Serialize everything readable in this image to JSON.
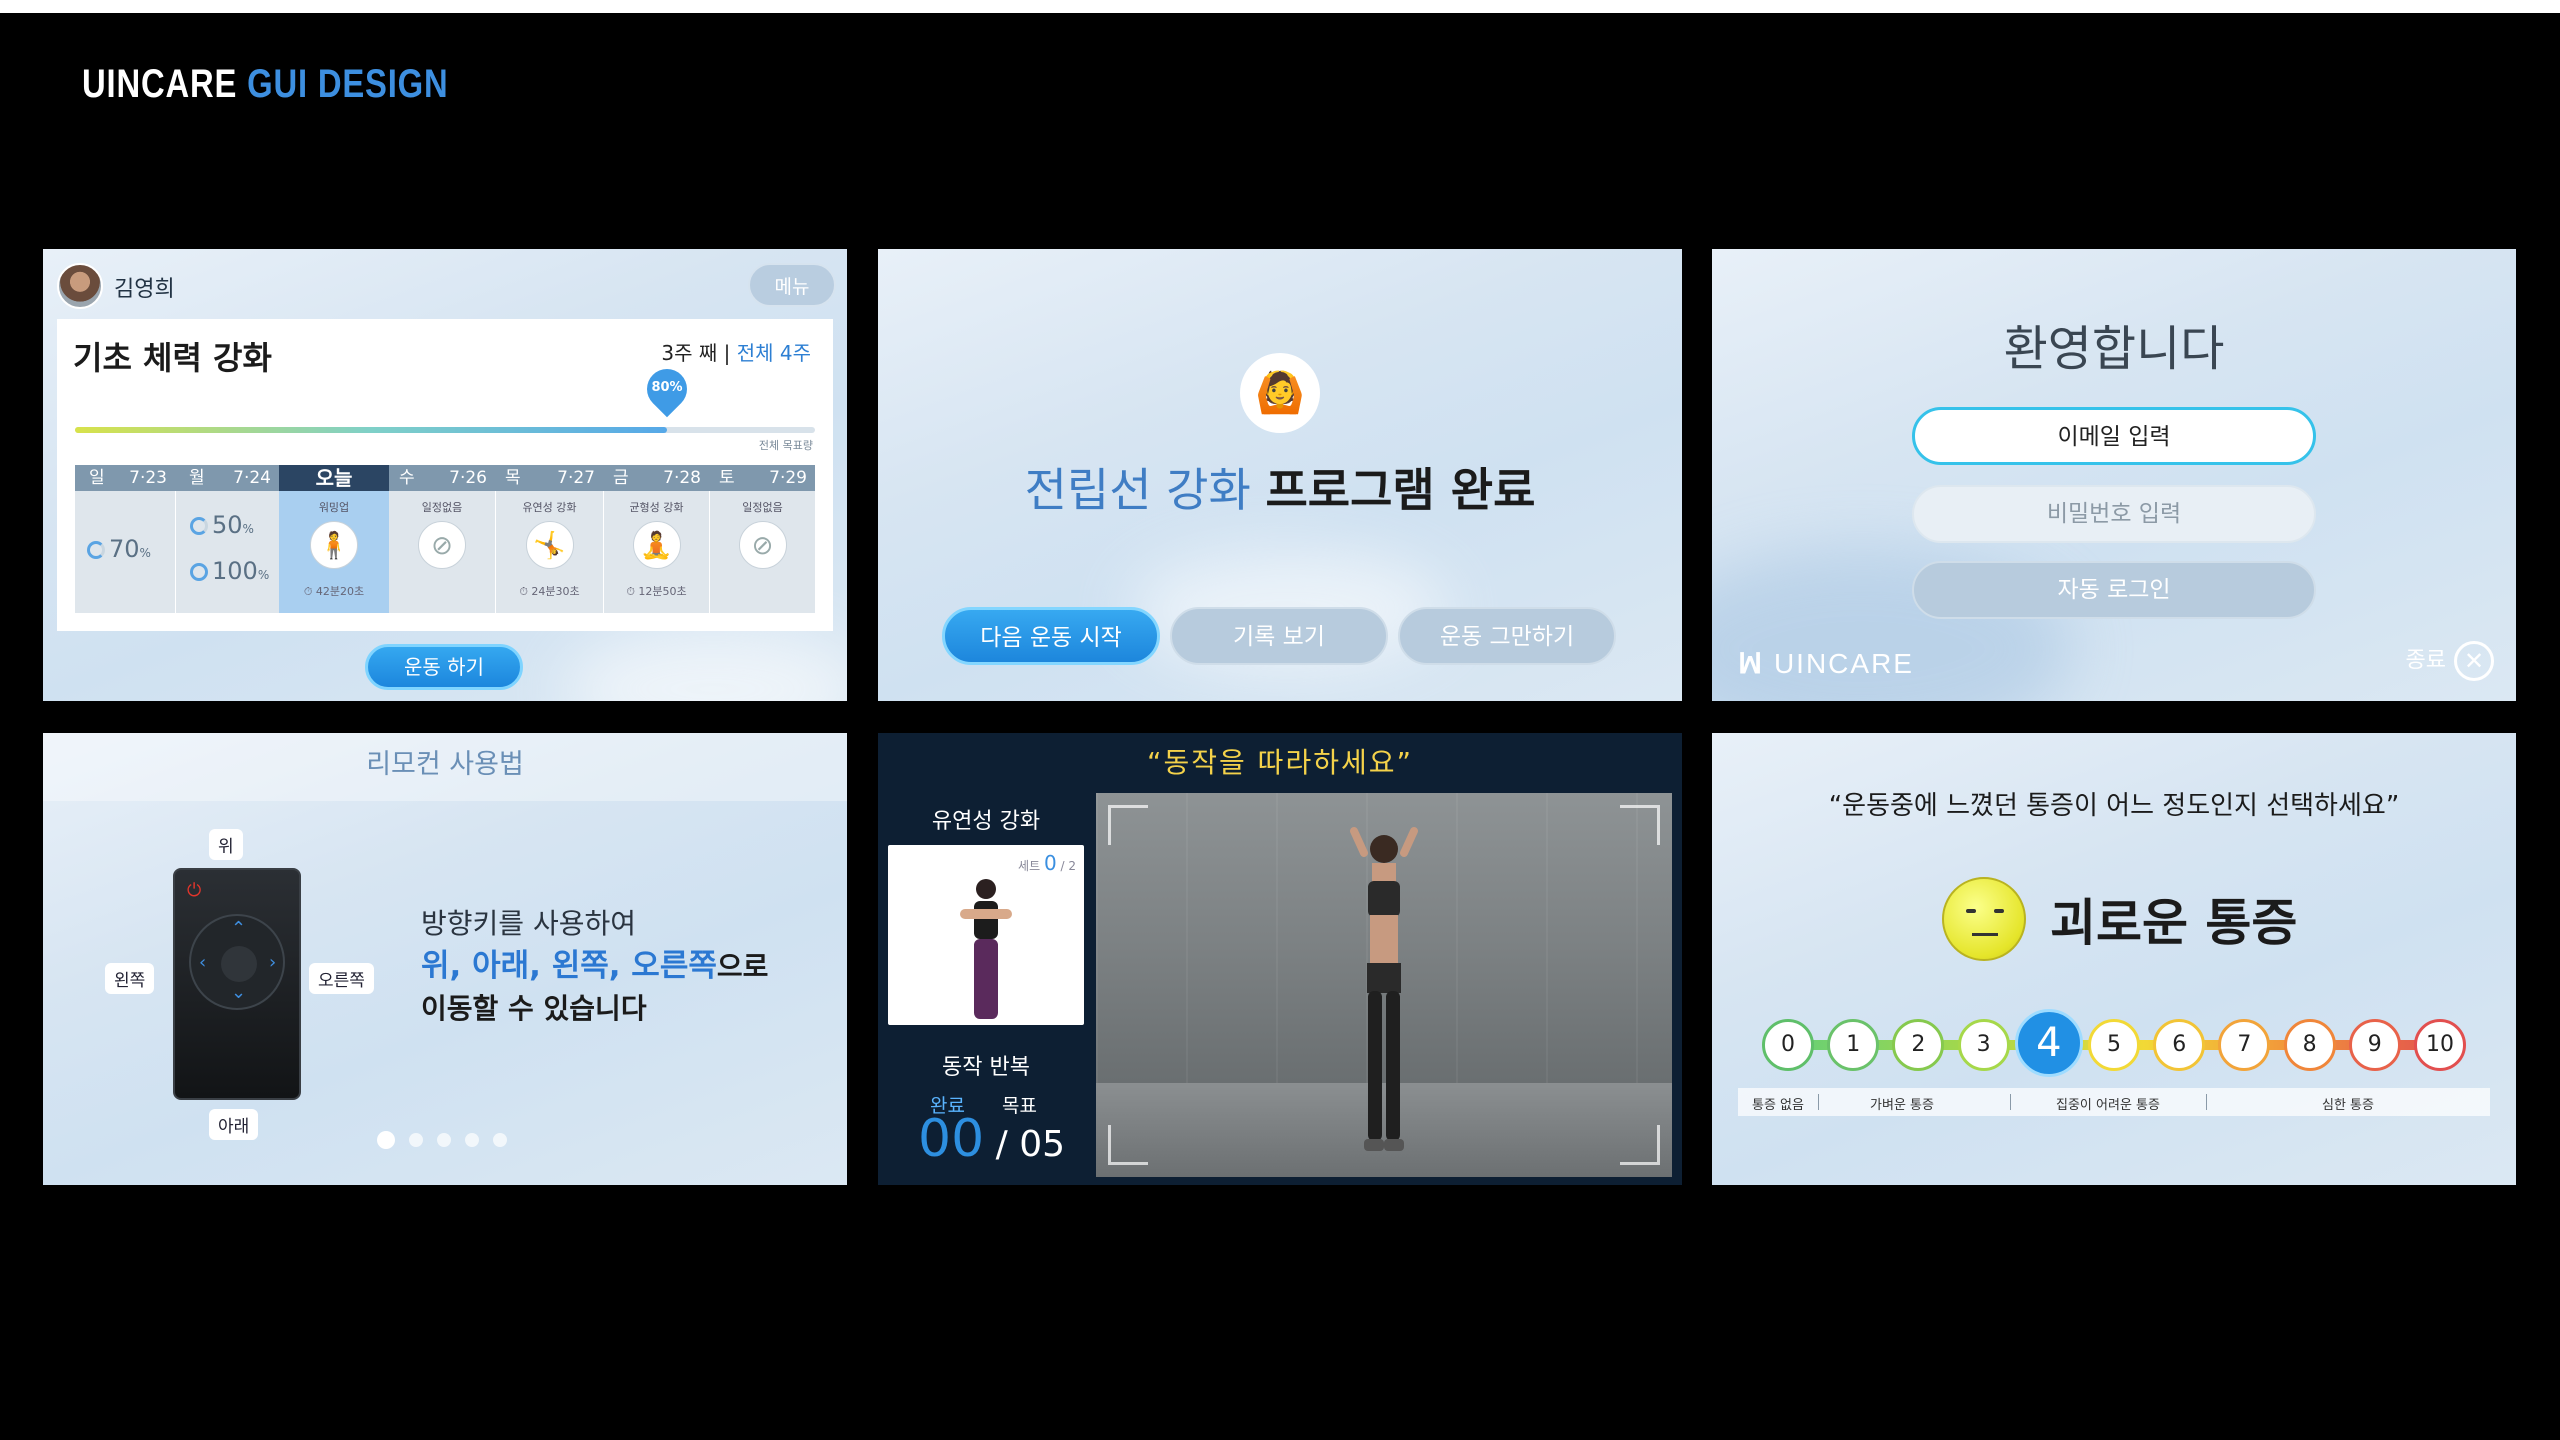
{
  "brand": {
    "part1": "UINCARE",
    "part2": "GUI DESIGN"
  },
  "panel1": {
    "user_name": "김영희",
    "menu_label": "메뉴",
    "program_title": "기초 체력 강화",
    "week_current": "3주 째",
    "week_total": "전체 4주",
    "progress_percent": 80,
    "progress_label": "80%",
    "goal_label": "전체 목표량",
    "days": [
      {
        "day": "일",
        "date": "7·23"
      },
      {
        "day": "월",
        "date": "7·24"
      },
      {
        "day": "오늘",
        "date": "",
        "activity": "워밍업",
        "time": "42분20초"
      },
      {
        "day": "수",
        "date": "7·26",
        "activity": "일정없음"
      },
      {
        "day": "목",
        "date": "7·27",
        "activity": "유연성 강화",
        "time": "24분30초"
      },
      {
        "day": "금",
        "date": "7·28",
        "activity": "균형성 강화",
        "time": "12분50초"
      },
      {
        "day": "토",
        "date": "7·29",
        "activity": "일정없음"
      }
    ],
    "stat_sun": "70",
    "stat_mon_1": "50",
    "stat_mon_2": "100",
    "pct_unit": "%",
    "start_button": "운동 하기"
  },
  "panel2": {
    "title_part1": "전립선 강화",
    "title_part2": "프로그램 완료",
    "buttons": [
      "다음 운동 시작",
      "기록 보기",
      "운동 그만하기"
    ]
  },
  "panel3": {
    "welcome": "환영합니다",
    "email_placeholder": "이메일 입력",
    "password_placeholder": "비밀번호 입력",
    "auto_login": "자동 로그인",
    "logo": "UINCARE",
    "exit_label": "종료"
  },
  "panel4": {
    "title": "리모컨 사용법",
    "tag_up": "위",
    "tag_left": "왼쪽",
    "tag_right": "오른쪽",
    "tag_down": "아래",
    "line1": "방향키를 사용하여",
    "line2_highlight": "위, 아래, 왼쪽, 오른쪽",
    "line2_rest": "으로",
    "line3": "이동할 수 있습니다",
    "page_dots": 5,
    "active_dot": 1
  },
  "panel5": {
    "instruction": "“동작을 따라하세요”",
    "exercise_name": "유연성 강화",
    "set_label": "세트",
    "set_current": "0",
    "set_total": "2",
    "repeat_label": "동작 반복",
    "done_label": "완료",
    "goal_label": "목표",
    "done_value": "00",
    "goal_value": "05"
  },
  "panel6": {
    "question": "“운동중에 느꼈던 통증이 어느 정도인지 선택하세요”",
    "pain_label": "괴로운 통증",
    "scale": [
      "0",
      "1",
      "2",
      "3",
      "4",
      "5",
      "6",
      "7",
      "8",
      "9",
      "10"
    ],
    "selected": 4,
    "scale_colors": [
      "#5fbf6a",
      "#6ac26a",
      "#86c94e",
      "#a6d84a",
      "#2190e4",
      "#f2d936",
      "#f2c436",
      "#f2a43a",
      "#f0863a",
      "#e8624a",
      "#e24f4f"
    ],
    "categories": [
      "통증 없음",
      "가벼운 통증",
      "집중이 어려운 통증",
      "심한 통증"
    ]
  }
}
